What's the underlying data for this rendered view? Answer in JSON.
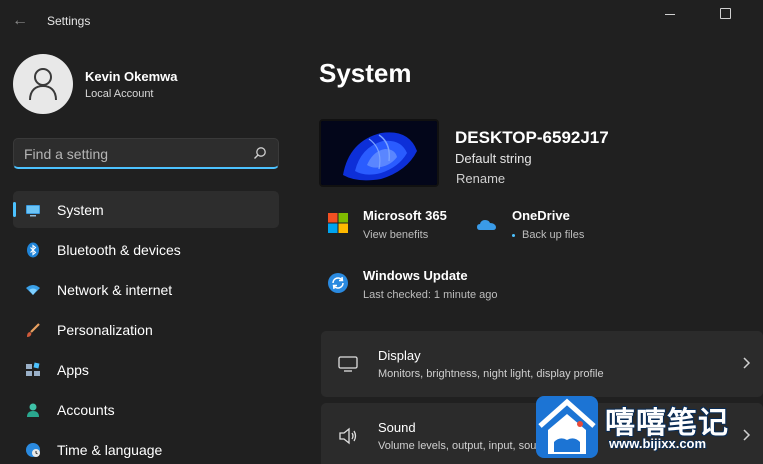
{
  "titlebar": {
    "app_title": "Settings"
  },
  "profile": {
    "name": "Kevin Okemwa",
    "account_type": "Local Account"
  },
  "search": {
    "placeholder": "Find a setting"
  },
  "nav": {
    "items": [
      {
        "label": "System",
        "icon": "monitor-icon",
        "active": true
      },
      {
        "label": "Bluetooth & devices",
        "icon": "bluetooth-icon"
      },
      {
        "label": "Network & internet",
        "icon": "wifi-icon"
      },
      {
        "label": "Personalization",
        "icon": "brush-icon"
      },
      {
        "label": "Apps",
        "icon": "apps-icon"
      },
      {
        "label": "Accounts",
        "icon": "person-icon"
      },
      {
        "label": "Time & language",
        "icon": "globe-clock-icon"
      }
    ]
  },
  "main": {
    "title": "System",
    "device": {
      "name": "DESKTOP-6592J17",
      "description": "Default string",
      "rename_label": "Rename"
    },
    "tiles": {
      "microsoft365": {
        "title": "Microsoft 365",
        "subtitle": "View benefits"
      },
      "onedrive": {
        "title": "OneDrive",
        "subtitle": "Back up files"
      },
      "windows_update": {
        "title": "Windows Update",
        "subtitle": "Last checked: 1 minute ago"
      }
    },
    "cards": {
      "display": {
        "title": "Display",
        "subtitle": "Monitors, brightness, night light, display profile"
      },
      "sound": {
        "title": "Sound",
        "subtitle": "Volume levels, output, input, sound devices"
      }
    }
  },
  "watermark": {
    "text": "嘻嘻笔记",
    "url": "www.bijixx.com"
  },
  "colors": {
    "accent": "#4cc2ff",
    "background": "#202020",
    "card": "#2b2b2b",
    "nav_active": "#2d2d2d"
  }
}
